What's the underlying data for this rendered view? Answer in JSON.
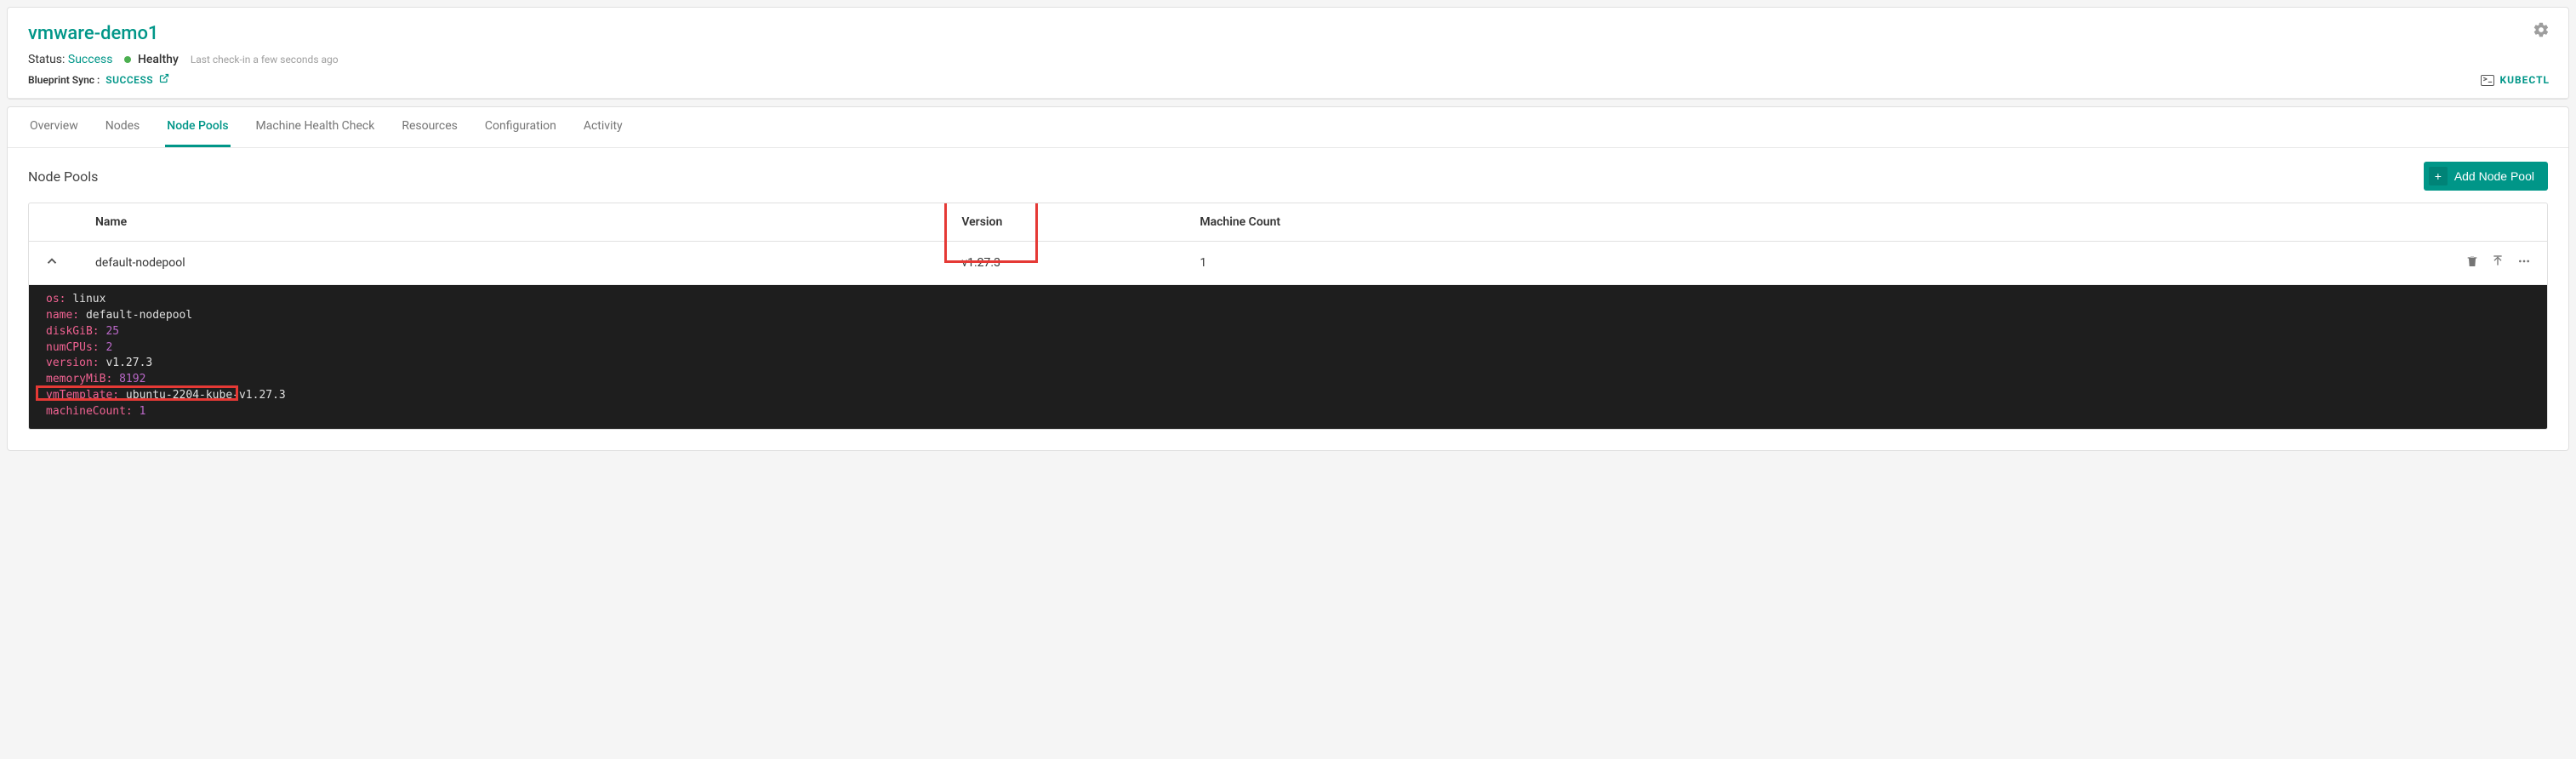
{
  "header": {
    "title": "vmware-demo1",
    "status_label": "Status:",
    "status_value": "Success",
    "health": "Healthy",
    "checkin": "Last check-in a few seconds ago",
    "sync_label": "Blueprint Sync :",
    "sync_value": "SUCCESS",
    "kubectl": "KUBECTL"
  },
  "tabs": {
    "overview": "Overview",
    "nodes": "Nodes",
    "nodepools": "Node Pools",
    "mhc": "Machine Health Check",
    "resources": "Resources",
    "config": "Configuration",
    "activity": "Activity"
  },
  "section": {
    "title": "Node Pools",
    "add_btn": "Add Node Pool"
  },
  "table": {
    "cols": {
      "name": "Name",
      "version": "Version",
      "mc": "Machine Count"
    },
    "row": {
      "name": "default-nodepool",
      "version": "v1.27.3",
      "mc": "1"
    }
  },
  "code": {
    "os_k": "os:",
    "os_v": "linux",
    "name_k": "name:",
    "name_v": "default-nodepool",
    "disk_k": "diskGiB:",
    "disk_v": "25",
    "cpu_k": "numCPUs:",
    "cpu_v": "2",
    "ver_k": "version:",
    "ver_v": "v1.27.3",
    "mem_k": "memoryMiB:",
    "mem_v": "8192",
    "tpl_k": "vmTemplate:",
    "tpl_v": "ubuntu-2204-kube-v1.27.3",
    "mc_k": "machineCount:",
    "mc_v": "1"
  }
}
